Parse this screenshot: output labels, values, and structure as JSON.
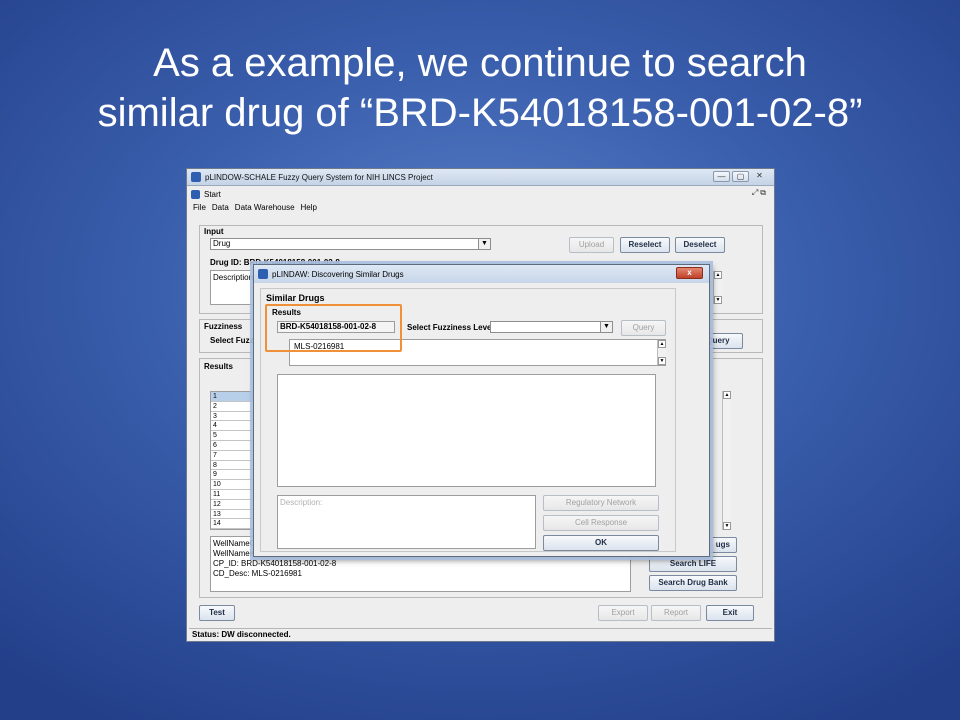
{
  "slide": {
    "title_line1": "As a example, we continue to search",
    "title_line2": "similar drug of “BRD-K54018158-001-02-8”"
  },
  "app": {
    "window_title": "pLINDOW-SCHALE Fuzzy Query System for NIH LINCS Project",
    "inner_title": "Start",
    "menu": [
      "File",
      "Data",
      "Data Warehouse",
      "Help"
    ],
    "input": {
      "label": "Input",
      "drug_combo": "Drug",
      "drug_id": "Drug ID: BRD-K54018158-001-02-8",
      "description_label": "Description:",
      "upload": "Upload",
      "reselect": "Reselect",
      "deselect": "Deselect"
    },
    "fuzziness": {
      "label": "Fuzziness",
      "select_label": "Select Fuzzi",
      "query": "Query"
    },
    "results": {
      "label": "Results",
      "rows": [
        "1",
        "2",
        "3",
        "4",
        "5",
        "6",
        "7",
        "8",
        "9",
        "10",
        "11",
        "12",
        "13",
        "14"
      ],
      "detail_lines": [
        "WellNameCF",
        "WellNameKE",
        "CP_ID: BRD-K54018158-001-02-8",
        "CD_Desc: MLS-0216981"
      ],
      "btn_drugs": "ugs",
      "btn_search_life": "Search LIFE",
      "btn_search_drugbank": "Search Drug Bank"
    },
    "bottom": {
      "test": "Test",
      "export": "Export",
      "report": "Report",
      "exit": "Exit"
    },
    "status": "Status: DW disconnected."
  },
  "dialog": {
    "title": "pLINDAW: Discovering Similar Drugs",
    "close": "x",
    "section_label": "Similar Drugs",
    "results_label": "Results",
    "drug_field": "BRD-K54018158-001-02-8",
    "fuzziness_label": "Select Fuzziness Level",
    "fuzziness_value": "",
    "query": "Query",
    "similar_list": [
      "MLS-0216981"
    ],
    "description_placeholder": "Description:",
    "regulatory_network": "Regulatory Network",
    "cell_response": "Cell Response",
    "ok": "OK"
  },
  "colors": {
    "highlight_box": "#f0913a",
    "background": "#3a5fad"
  }
}
